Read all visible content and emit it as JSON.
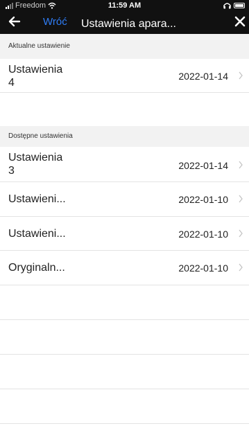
{
  "status_bar": {
    "carrier": "Freedom",
    "time": "11:59 AM"
  },
  "nav": {
    "back_label": "Wróć",
    "title": "Ustawienia apara...",
    "icons": {
      "back": "back-arrow-icon",
      "close": "close-icon"
    }
  },
  "current_section": {
    "header": "Aktualne ustawienie",
    "items": [
      {
        "title_line1": "Ustawienia",
        "title_line2": "4",
        "date": "2022-01-14"
      }
    ]
  },
  "available_section": {
    "header": "Dostępne ustawienia",
    "items": [
      {
        "title_line1": "Ustawienia",
        "title_line2": "3",
        "date": "2022-01-14"
      },
      {
        "title": "Ustawieni...",
        "date": "2022-01-10"
      },
      {
        "title": "Ustawieni...",
        "date": "2022-01-10"
      },
      {
        "title": "Oryginaln...",
        "date": "2022-01-10"
      }
    ]
  },
  "colors": {
    "header_bg": "#111111",
    "accent": "#2f7df6",
    "section_bg": "#f2f2f2",
    "divider": "#e3e3e3"
  }
}
